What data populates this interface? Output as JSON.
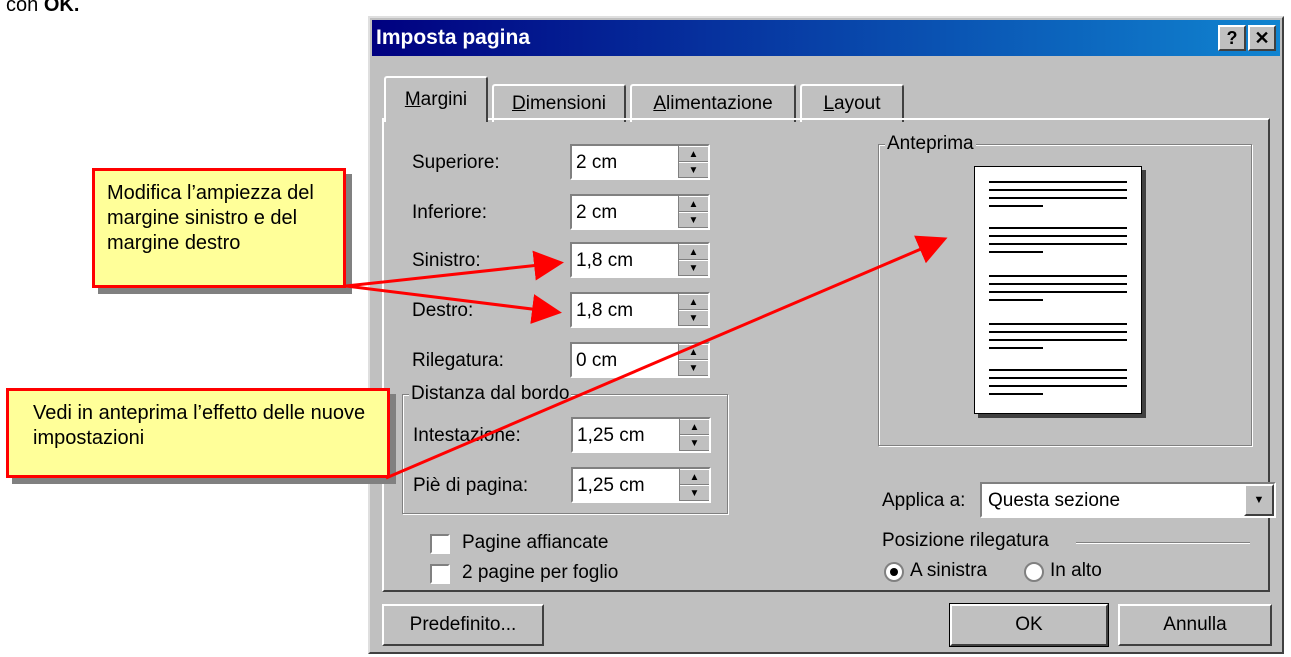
{
  "doc_text": {
    "prefix": "con ",
    "bold": "OK."
  },
  "dialog": {
    "title": "Imposta pagina",
    "help_glyph": "?",
    "close_glyph": "✕",
    "tabs": [
      {
        "pre": "",
        "u": "M",
        "post": "argini"
      },
      {
        "pre": "",
        "u": "D",
        "post": "imensioni"
      },
      {
        "pre": "",
        "u": "A",
        "post": "limentazione"
      },
      {
        "pre": "",
        "u": "L",
        "post": "ayout"
      }
    ],
    "fields": [
      {
        "label": "Superiore:",
        "value": "2 cm"
      },
      {
        "label": "Inferiore:",
        "value": "2 cm"
      },
      {
        "label": "Sinistro:",
        "value": "1,8 cm"
      },
      {
        "label": "Destro:",
        "value": "1,8 cm"
      },
      {
        "label": "Rilegatura:",
        "value": "0 cm"
      }
    ],
    "distance_group": {
      "title": "Distanza dal bordo",
      "fields": [
        {
          "label": "Intestazione:",
          "value": "1,25 cm"
        },
        {
          "label": "Piè di pagina:",
          "value": "1,25 cm"
        }
      ]
    },
    "checkboxes": [
      {
        "label": "Pagine affiancate",
        "checked": false
      },
      {
        "label": "2 pagine per foglio",
        "checked": false
      }
    ],
    "preview": {
      "title": "Anteprima"
    },
    "apply_to": {
      "label": "Applica a:",
      "value": "Questa sezione"
    },
    "gutter_position": {
      "title": "Posizione rilegatura",
      "options": [
        {
          "label": "A sinistra",
          "selected": true
        },
        {
          "label": "In alto",
          "selected": false
        }
      ]
    },
    "buttons": {
      "default_label": "Predefinito...",
      "ok_label": "OK",
      "cancel_label": "Annulla"
    }
  },
  "callouts": [
    {
      "text": "Modifica l’ampiezza del margine sinistro e del margine destro"
    },
    {
      "text": "Vedi in anteprima l’effetto delle nuove impostazioni"
    }
  ],
  "colors": {
    "callout_border": "#ff0000",
    "callout_fill": "#ffff99",
    "titlebar": "#000080"
  }
}
